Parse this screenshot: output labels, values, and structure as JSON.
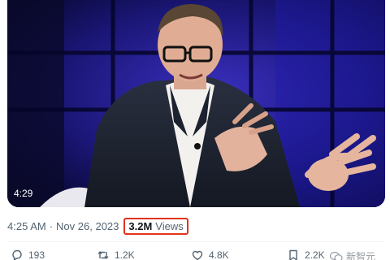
{
  "video": {
    "duration": "4:29"
  },
  "post_meta": {
    "time": "4:25 AM",
    "separator": "·",
    "date": "Nov 26, 2023",
    "views_count": "3.2M",
    "views_label": "Views",
    "highlight_color": "#e2331c"
  },
  "actions": {
    "reply": {
      "icon": "reply-icon",
      "count": "193"
    },
    "repost": {
      "icon": "repost-icon",
      "count": "1.2K"
    },
    "like": {
      "icon": "like-icon",
      "count": "4.8K"
    },
    "bookmark": {
      "icon": "bookmark-icon",
      "count": "2.2K"
    }
  },
  "watermark": {
    "text": "新智元"
  }
}
